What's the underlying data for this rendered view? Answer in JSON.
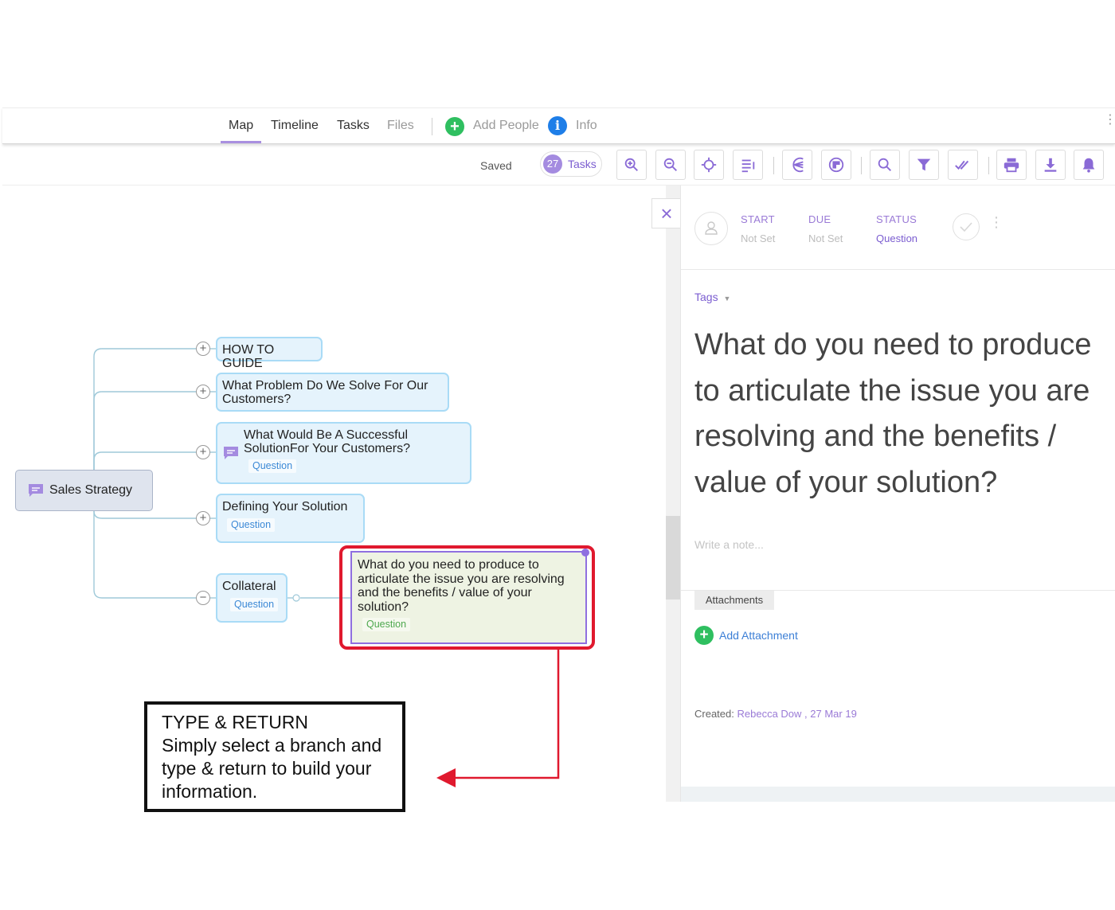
{
  "nav": {
    "tabs": [
      {
        "label": "Map",
        "active": true
      },
      {
        "label": "Timeline",
        "active": false
      },
      {
        "label": "Tasks",
        "active": false
      },
      {
        "label": "Files",
        "active": false
      }
    ],
    "add_people": "Add People",
    "info": "Info"
  },
  "toolbar": {
    "saved": "Saved",
    "tasks_count": "27",
    "tasks_label": "Tasks",
    "buttons": [
      "zoom-in",
      "zoom-out",
      "center",
      "outline",
      "layout-left",
      "layout-right",
      "search",
      "filter",
      "complete",
      "print",
      "download",
      "notifications"
    ]
  },
  "map": {
    "root": {
      "label": "Sales Strategy"
    },
    "branches": [
      {
        "label": "HOW TO GUIDE"
      },
      {
        "label": "What Problem Do We Solve For Our Customers?"
      },
      {
        "label": "What Would Be A Successful SolutionFor Your Customers?",
        "badge": "Question"
      },
      {
        "label": "Defining Your Solution",
        "badge": "Question"
      },
      {
        "label": "Collateral",
        "badge": "Question"
      }
    ],
    "selected": {
      "label": "What do you need to produce to articulate the issue you are resolving and the benefits / value of your solution?",
      "badge": "Question"
    }
  },
  "panel": {
    "start_label": "START",
    "start_value": "Not Set",
    "due_label": "DUE",
    "due_value": "Not Set",
    "status_label": "STATUS",
    "status_value": "Question",
    "tags": "Tags",
    "title": "What do you need to produce to articulate the issue you are resolving and the benefits / value of your solution?",
    "note_placeholder": "Write a note...",
    "attachments": "Attachments",
    "add_attachment": "Add Attachment",
    "created_prefix": "Created:",
    "created_by": "Rebecca Dow , 27 Mar 19"
  },
  "callout": {
    "title": "TYPE & RETURN",
    "body": "Simply select a branch and type & return to build your information."
  },
  "colors": {
    "accent_purple": "#a990e0",
    "node_fill": "#e5f3fc",
    "node_border": "#a9dbf6",
    "selected_fill": "#eef3e3",
    "highlight_red": "#e0192e",
    "green": "#2fbf60",
    "blue": "#1e7ee8"
  }
}
